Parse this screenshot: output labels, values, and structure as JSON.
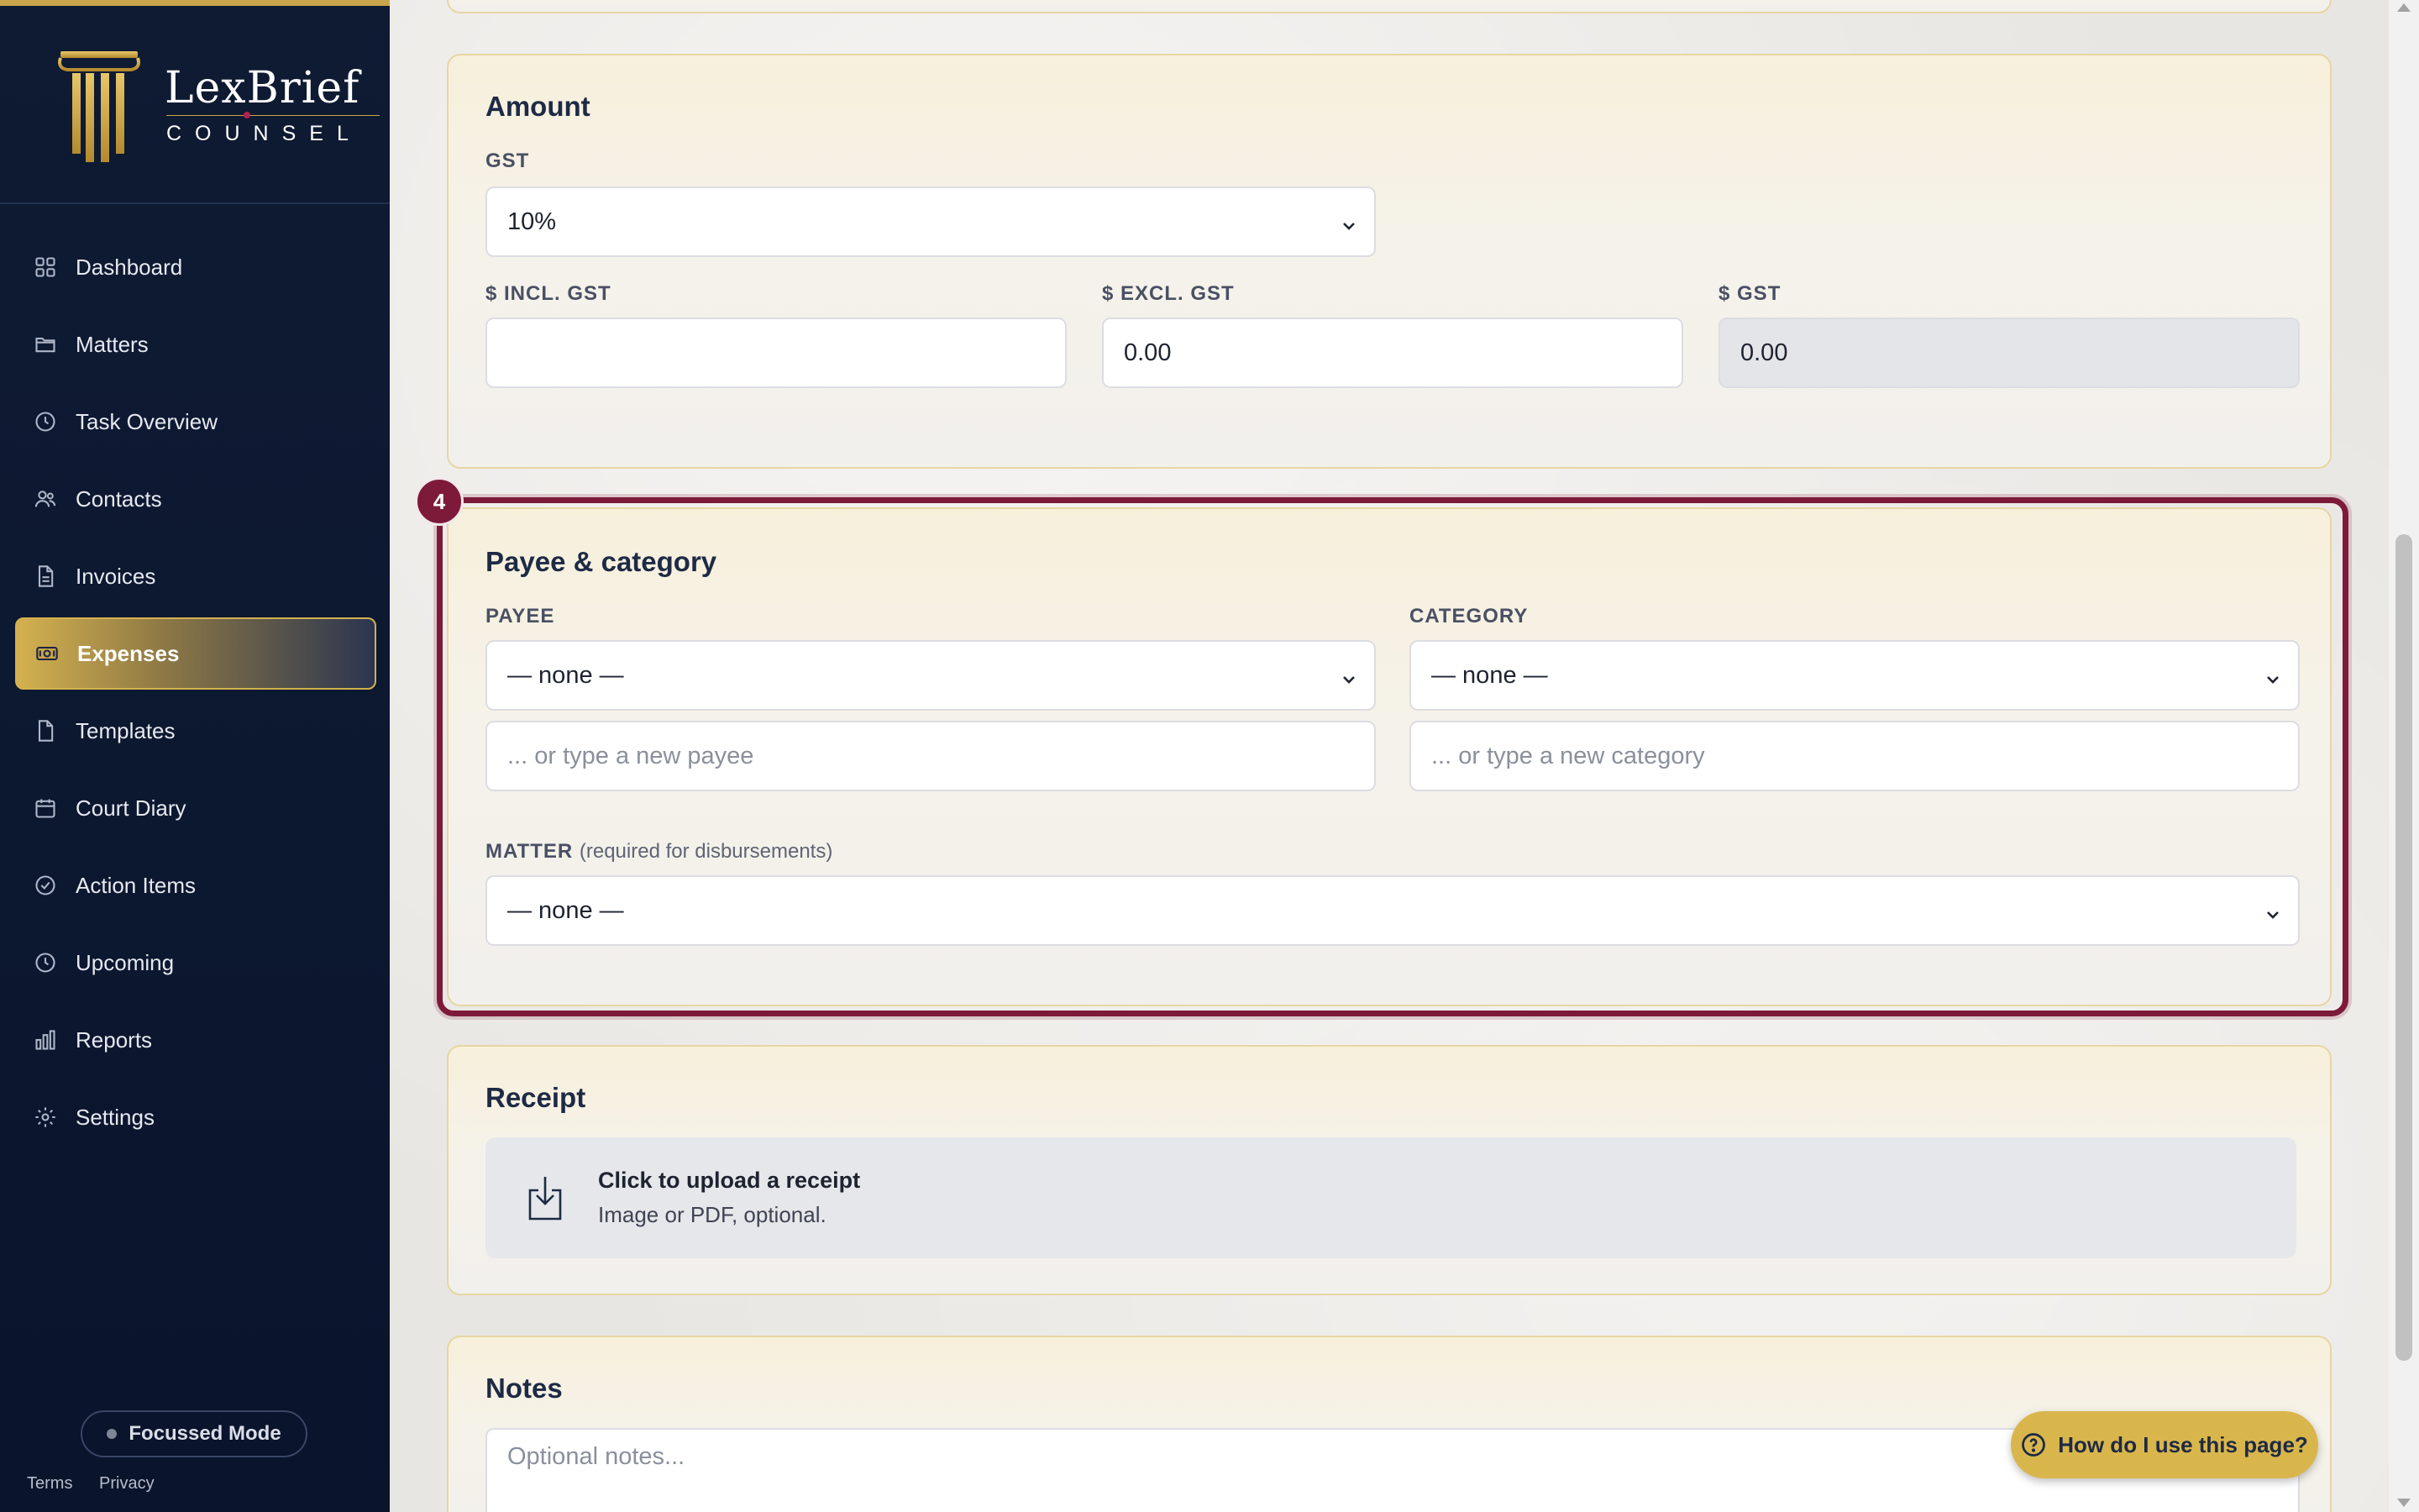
{
  "brand": {
    "name": "LexBrief",
    "tagline": "COUNSEL"
  },
  "sidebar": {
    "items": [
      {
        "label": "Dashboard",
        "icon": "grid-icon"
      },
      {
        "label": "Matters",
        "icon": "folder-icon"
      },
      {
        "label": "Task Overview",
        "icon": "clock-icon"
      },
      {
        "label": "Contacts",
        "icon": "users-icon"
      },
      {
        "label": "Invoices",
        "icon": "file-text-icon"
      },
      {
        "label": "Expenses",
        "icon": "cash-icon",
        "active": true
      },
      {
        "label": "Templates",
        "icon": "file-icon"
      },
      {
        "label": "Court Diary",
        "icon": "calendar-icon"
      },
      {
        "label": "Action Items",
        "icon": "check-circle-icon"
      },
      {
        "label": "Upcoming",
        "icon": "clock-icon"
      },
      {
        "label": "Reports",
        "icon": "bar-chart-icon"
      },
      {
        "label": "Settings",
        "icon": "gear-icon"
      }
    ],
    "focus_mode": "Focussed Mode",
    "terms": "Terms",
    "privacy": "Privacy"
  },
  "amount": {
    "title": "Amount",
    "gst_label": "GST",
    "gst_value": "10%",
    "incl_label": "$ INCL. GST",
    "incl_value": "",
    "excl_label": "$ EXCL. GST",
    "excl_value": "0.00",
    "gst_amount_label": "$ GST",
    "gst_amount_value": "0.00"
  },
  "payee": {
    "step": "4",
    "title": "Payee & category",
    "payee_label": "PAYEE",
    "payee_value": "— none —",
    "payee_placeholder": "... or type a new payee",
    "category_label": "CATEGORY",
    "category_value": "— none —",
    "category_placeholder": "... or type a new category",
    "matter_label": "MATTER",
    "matter_note": "(required for disbursements)",
    "matter_value": "— none —"
  },
  "receipt": {
    "title": "Receipt",
    "upload_title": "Click to upload a receipt",
    "upload_sub": "Image or PDF, optional."
  },
  "notes": {
    "title": "Notes",
    "placeholder": "Optional notes..."
  },
  "help": {
    "label": "How do I use this page?"
  },
  "colors": {
    "accent_gold": "#d4b14f",
    "highlight": "#7d1a3a",
    "sidebar_bg": "#0f1a33"
  }
}
